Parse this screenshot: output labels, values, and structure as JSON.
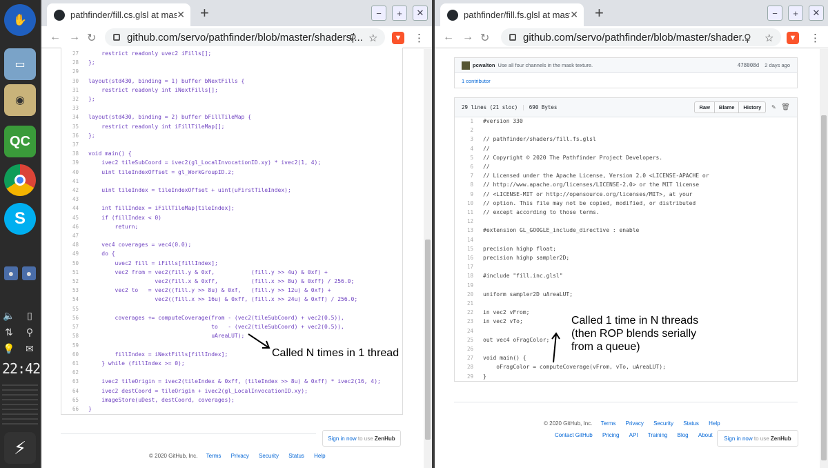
{
  "dock": {
    "clock": "22:42"
  },
  "left": {
    "tab_title": "pathfinder/fill.cs.glsl at master",
    "url": "github.com/servo/pathfinder/blob/master/shaders/...",
    "line_numbers": "27\n28\n29\n30\n31\n32\n33\n34\n35\n36\n37\n38\n39\n40\n41\n42\n43\n44\n45\n46\n47\n48\n49\n50\n51\n52\n53\n54\n55\n56\n57\n58\n59\n60\n61\n62\n63\n64\n65\n66",
    "code": "    restrict readonly uvec2 iFills[];\n};\n\nlayout(std430, binding = 1) buffer bNextFills {\n    restrict readonly int iNextFills[];\n};\n\nlayout(std430, binding = 2) buffer bFillTileMap {\n    restrict readonly int iFillTileMap[];\n};\n\nvoid main() {\n    ivec2 tileSubCoord = ivec2(gl_LocalInvocationID.xy) * ivec2(1, 4);\n    uint tileIndexOffset = gl_WorkGroupID.z;\n\n    uint tileIndex = tileIndexOffset + uint(uFirstTileIndex);\n\n    int fillIndex = iFillTileMap[tileIndex];\n    if (fillIndex < 0)\n        return;\n\n    vec4 coverages = vec4(0.0);\n    do {\n        uvec2 fill = iFills[fillIndex];\n        vec2 from = vec2(fill.y & 0xf,           (fill.y >> 4u) & 0xf) +\n                    vec2(fill.x & 0xff,          (fill.x >> 8u) & 0xff) / 256.0;\n        vec2 to   = vec2((fill.y >> 8u) & 0xf,   (fill.y >> 12u) & 0xf) +\n                    vec2((fill.x >> 16u) & 0xff, (fill.x >> 24u) & 0xff) / 256.0;\n\n        coverages += computeCoverage(from - (vec2(tileSubCoord) + vec2(0.5)),\n                                     to   - (vec2(tileSubCoord) + vec2(0.5)),\n                                     uAreaLUT);\n\n        fillIndex = iNextFills[fillIndex];\n    } while (fillIndex >= 0);\n\n    ivec2 tileOrigin = ivec2(tileIndex & 0xff, (tileIndex >> 8u) & 0xff) * ivec2(16, 4);\n    ivec2 destCoord = tileOrigin + ivec2(gl_LocalInvocationID.xy);\n    imageStore(uDest, destCoord, coverages);\n}",
    "annotation": "Called N times in 1 thread",
    "zenhub_signin": "Sign in now",
    "zenhub_rest": " to use ",
    "zenhub_brand": "ZenHub",
    "footer_copy": "© 2020 GitHub, Inc.",
    "footer_links": [
      "Terms",
      "Privacy",
      "Security",
      "Status",
      "Help"
    ]
  },
  "right": {
    "tab_title": "pathfinder/fill.fs.glsl at master",
    "url": "github.com/servo/pathfinder/blob/master/shader...",
    "commit_author": "pcwalton",
    "commit_message": "Use all four channels in the mask texture.",
    "commit_sha": "478008d",
    "commit_age": "2 days ago",
    "contributors": "1 contributor",
    "file_stats": "29 lines (21 sloc)",
    "file_size": "690 Bytes",
    "buttons": {
      "raw": "Raw",
      "blame": "Blame",
      "history": "History"
    },
    "line_numbers": "1\n2\n3\n4\n5\n6\n7\n8\n9\n10\n11\n12\n13\n14\n15\n16\n17\n18\n19\n20\n21\n22\n23\n24\n25\n26\n27\n28\n29",
    "code": "#version 330\n\n// pathfinder/shaders/fill.fs.glsl\n//\n// Copyright © 2020 The Pathfinder Project Developers.\n//\n// Licensed under the Apache License, Version 2.0 <LICENSE-APACHE or\n// http://www.apache.org/licenses/LICENSE-2.0> or the MIT license\n// <LICENSE-MIT or http://opensource.org/licenses/MIT>, at your\n// option. This file may not be copied, modified, or distributed\n// except according to those terms.\n\n#extension GL_GOOGLE_include_directive : enable\n\nprecision highp float;\nprecision highp sampler2D;\n\n#include \"fill.inc.glsl\"\n\nuniform sampler2D uAreaLUT;\n\nin vec2 vFrom;\nin vec2 vTo;\n\nout vec4 oFragColor;\n\nvoid main() {\n    oFragColor = computeCoverage(vFrom, vTo, uAreaLUT);\n}",
    "annotation": "Called 1 time in N threads\n(then ROP blends serially\nfrom a queue)",
    "zenhub_signin": "Sign in now",
    "zenhub_rest": " to use ",
    "zenhub_brand": "ZenHub",
    "footer_copy": "© 2020 GitHub, Inc.",
    "footer_links": [
      "Terms",
      "Privacy",
      "Security",
      "Status",
      "Help"
    ],
    "footer_links2": [
      "Contact GitHub",
      "Pricing",
      "API",
      "Training",
      "Blog",
      "About"
    ]
  }
}
